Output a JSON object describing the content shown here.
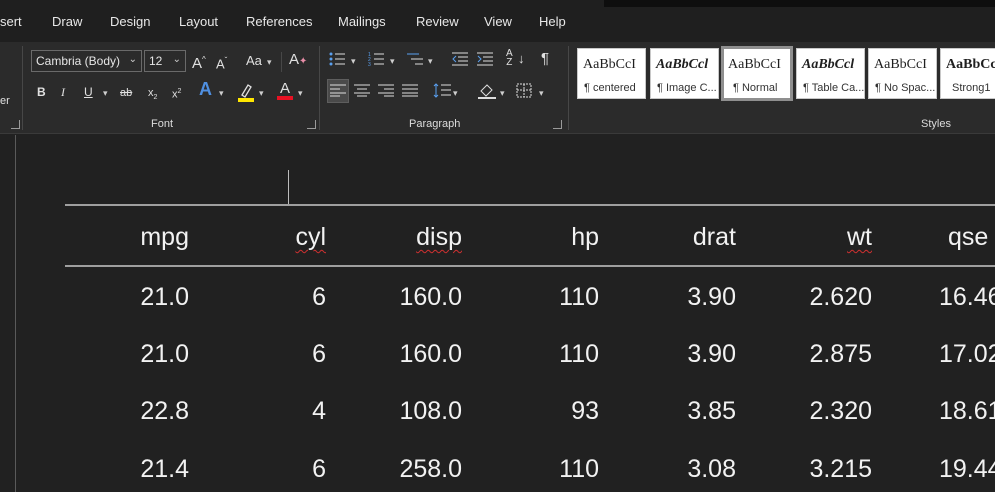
{
  "menu": {
    "tabs": [
      "sert",
      "Draw",
      "Design",
      "Layout",
      "References",
      "Mailings",
      "Review",
      "View",
      "Help"
    ]
  },
  "ribbon": {
    "left_partial_text": "er",
    "font": {
      "font_name": "Cambria (Body)",
      "font_size": "12",
      "group_label": "Font",
      "highlight_color": "#ffe600",
      "font_color": "#e81123"
    },
    "paragraph": {
      "group_label": "Paragraph"
    },
    "styles": {
      "group_label": "Styles",
      "items": [
        {
          "sample": "AaBbCcI",
          "name": "¶ centered"
        },
        {
          "sample": "AaBbCcl",
          "name": "¶ Image C..."
        },
        {
          "sample": "AaBbCcI",
          "name": "¶ Normal"
        },
        {
          "sample": "AaBbCcl",
          "name": "¶ Table Ca..."
        },
        {
          "sample": "AaBbCcI",
          "name": "¶ No Spac..."
        },
        {
          "sample": "AaBbCc",
          "name": "Strong1"
        }
      ],
      "selected_index": 2
    }
  },
  "table": {
    "headers": [
      "mpg",
      "cyl",
      "disp",
      "hp",
      "drat",
      "wt",
      "qse"
    ],
    "rows": [
      [
        "21.0",
        "6",
        "160.0",
        "110",
        "3.90",
        "2.620",
        "16.46"
      ],
      [
        "21.0",
        "6",
        "160.0",
        "110",
        "3.90",
        "2.875",
        "17.02"
      ],
      [
        "22.8",
        "4",
        "108.0",
        "93",
        "3.85",
        "2.320",
        "18.61"
      ],
      [
        "21.4",
        "6",
        "258.0",
        "110",
        "3.08",
        "3.215",
        "19.44"
      ]
    ]
  }
}
